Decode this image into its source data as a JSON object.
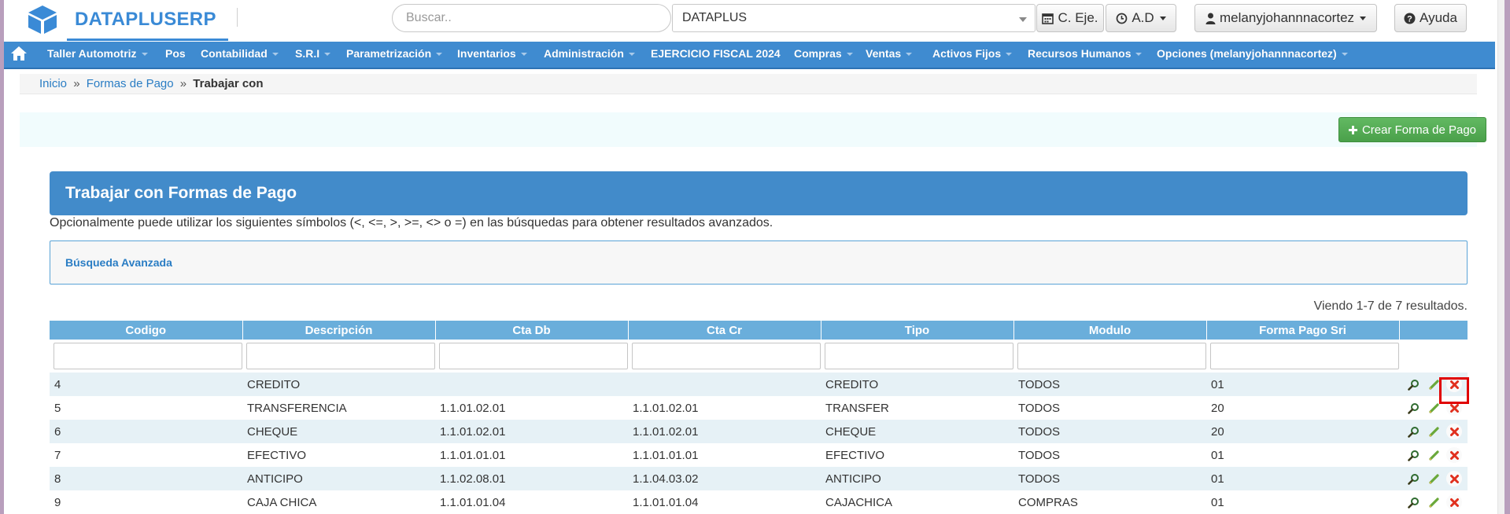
{
  "brand": {
    "name": "DATAPLUSERP"
  },
  "search": {
    "placeholder": "Buscar.."
  },
  "company_select": {
    "value": "DATAPLUS"
  },
  "toolbar": {
    "calendar_label": "C. Eje.",
    "ad_label": "A.D",
    "user_label": "melanyjohannnacortez",
    "help_label": "Ayuda"
  },
  "nav": {
    "items": [
      {
        "label": "Taller Automotriz",
        "caret": true
      },
      {
        "label": "Pos",
        "caret": false
      },
      {
        "label": "Contabilidad",
        "caret": true
      },
      {
        "label": "S.R.I",
        "caret": true
      },
      {
        "label": "Parametrización",
        "caret": true
      },
      {
        "label": "Inventarios",
        "caret": true
      },
      {
        "label": "Administración",
        "caret": true
      },
      {
        "label": "EJERCICIO FISCAL 2024",
        "caret": false
      },
      {
        "label": "Compras",
        "caret": true
      },
      {
        "label": "Ventas",
        "caret": true
      },
      {
        "label": "Activos Fijos",
        "caret": true
      },
      {
        "label": "Recursos Humanos",
        "caret": true
      },
      {
        "label": "Opciones (melanyjohannnacortez)",
        "caret": true
      }
    ]
  },
  "breadcrumb": {
    "home": "Inicio",
    "section": "Formas de Pago",
    "separator": "»",
    "current": "Trabajar con"
  },
  "actions": {
    "create_label": "Crear Forma de Pago"
  },
  "panel": {
    "title": "Trabajar con Formas de Pago",
    "hint": "Opcionalmente puede utilizar los siguientes símbolos (<, <=, >, >=, <> o =) en las búsquedas para obtener resultados avanzados.",
    "advanced_search": "Búsqueda Avanzada",
    "summary": "Viendo 1-7 de 7 resultados."
  },
  "table": {
    "columns": [
      "Codigo",
      "Descripción",
      "Cta Db",
      "Cta Cr",
      "Tipo",
      "Modulo",
      "Forma Pago Sri"
    ],
    "rows": [
      [
        "4",
        "CREDITO",
        "",
        "",
        "CREDITO",
        "TODOS",
        "01"
      ],
      [
        "5",
        "TRANSFERENCIA",
        "1.1.01.02.01",
        "1.1.01.02.01",
        "TRANSFER",
        "TODOS",
        "20"
      ],
      [
        "6",
        "CHEQUE",
        "1.1.01.02.01",
        "1.1.01.02.01",
        "CHEQUE",
        "TODOS",
        "20"
      ],
      [
        "7",
        "EFECTIVO",
        "1.1.01.01.01",
        "1.1.01.01.01",
        "EFECTIVO",
        "TODOS",
        "01"
      ],
      [
        "8",
        "ANTICIPO",
        "1.1.02.08.01",
        "1.1.04.03.02",
        "ANTICIPO",
        "TODOS",
        "01"
      ],
      [
        "9",
        "CAJA CHICA",
        "1.1.01.01.04",
        "1.1.01.01.04",
        "CAJACHICA",
        "COMPRAS",
        "01"
      ]
    ]
  },
  "icons": {
    "view": "magnifier-icon",
    "edit": "pencil-icon",
    "delete": "cross-icon",
    "brand": "cube-icon",
    "home": "home-icon",
    "calendar": "calendar-icon",
    "clock": "clock-icon",
    "user": "user-icon",
    "help": "question-icon",
    "plus": "plus-icon"
  },
  "colors": {
    "brand": "#3a8ad6",
    "nav": "#3f8bd0",
    "panel_header": "#428bca",
    "table_header": "#6aaedb",
    "create_button": "#4aa04a",
    "delete": "#e0301e",
    "highlight": "#e00000"
  }
}
